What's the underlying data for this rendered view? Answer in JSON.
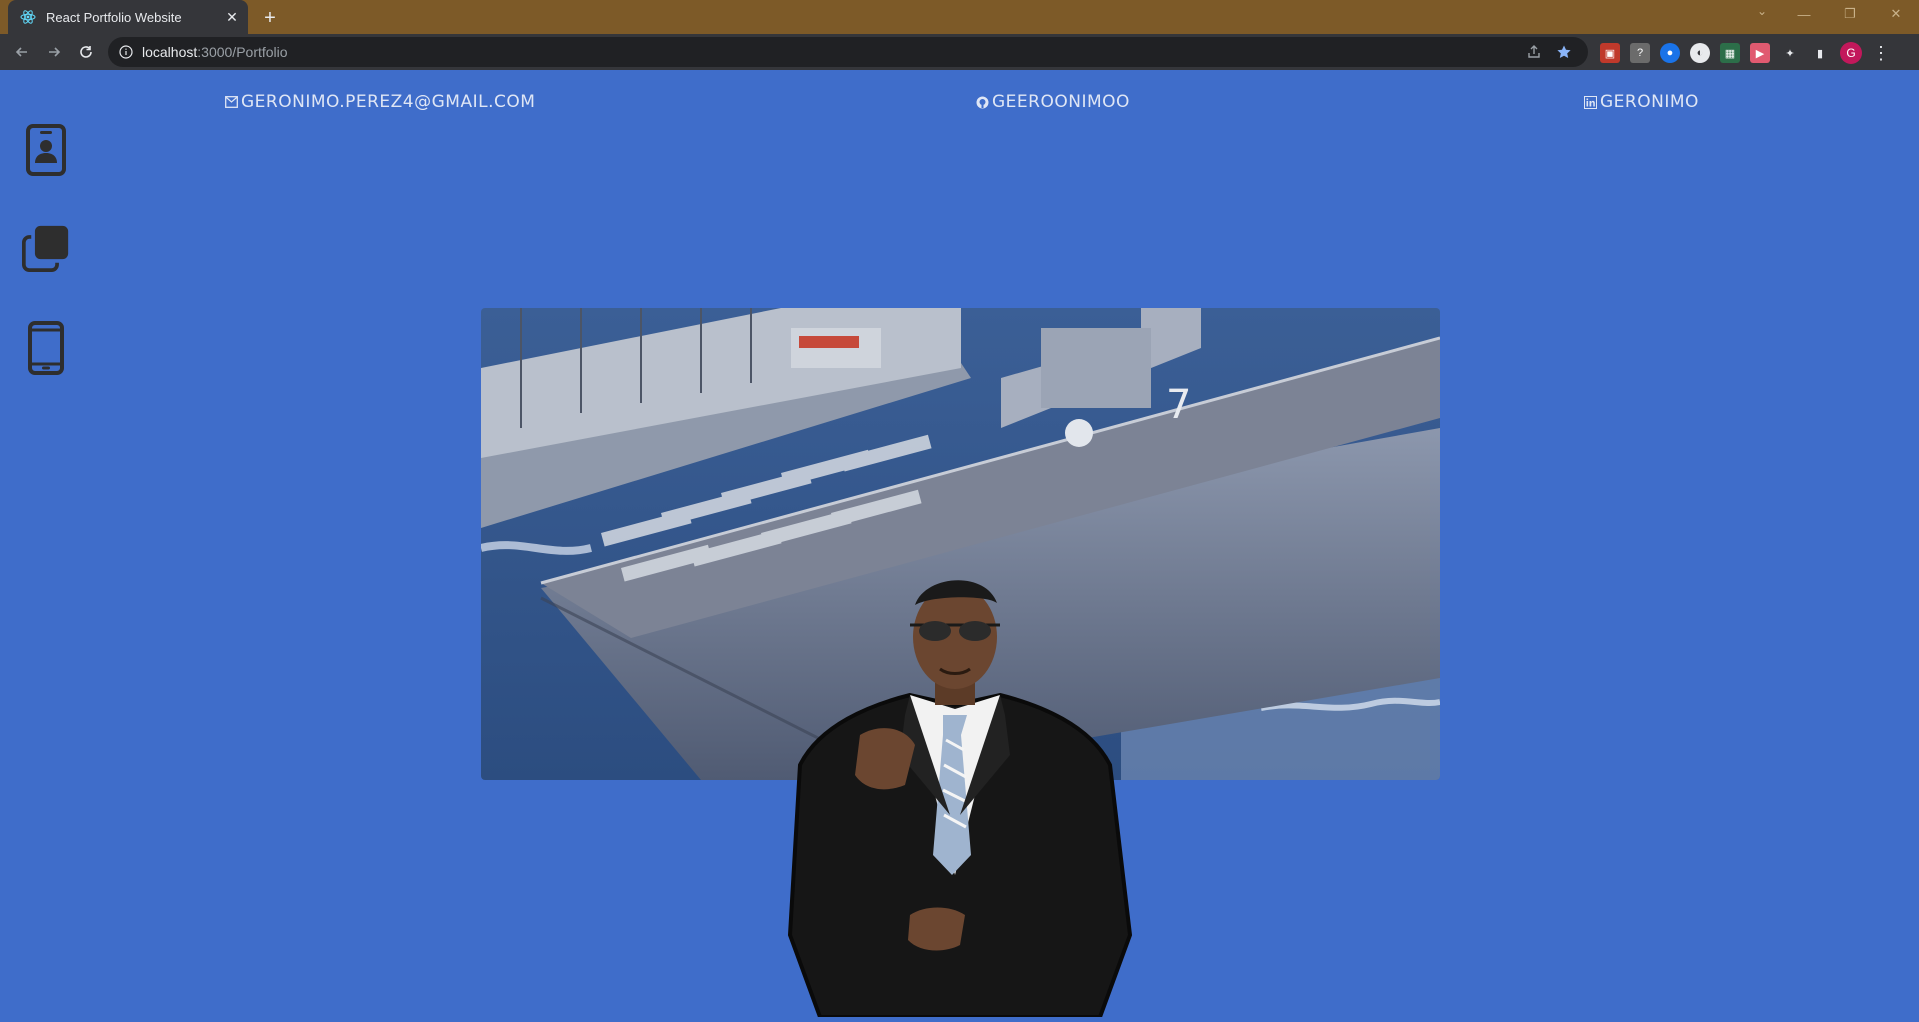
{
  "browser": {
    "tab_title": "React Portfolio Website",
    "url_host": "localhost",
    "url_rest": ":3000/Portfolio",
    "profile_initial": "G"
  },
  "contacts": {
    "email": "geronimo.perez4@gmail.com",
    "github": "Geeroonimoo",
    "linkedin": "Geronimo"
  },
  "sidenav": {
    "items": [
      {
        "icon": "contact-card-icon"
      },
      {
        "icon": "portfolio-copy-icon"
      },
      {
        "icon": "phone-icon"
      }
    ]
  },
  "colors": {
    "page_background": "#3f6dca",
    "titlebar": "#7d5a28",
    "toolbar": "#35363a",
    "icon": "#2e2e2e"
  }
}
